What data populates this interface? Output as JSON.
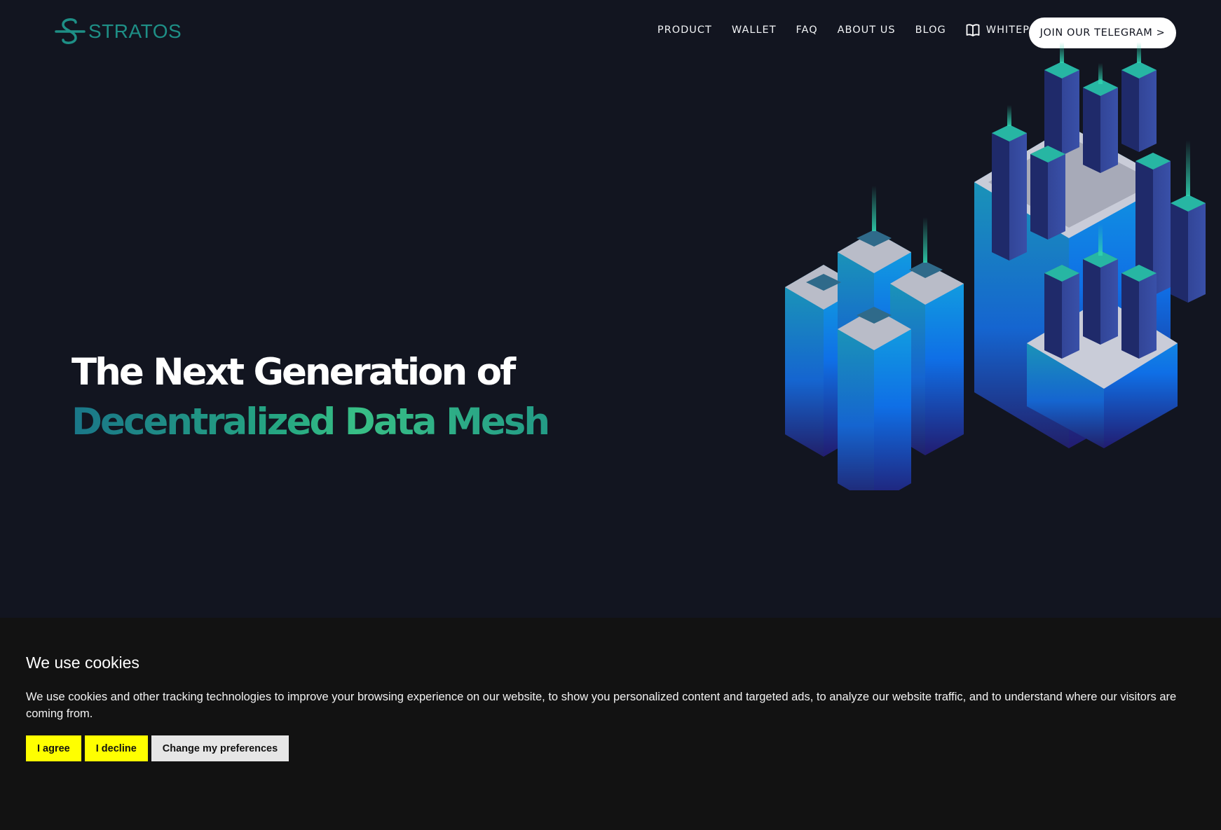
{
  "header": {
    "logo_text": "STRATOS",
    "nav": [
      "PRODUCT",
      "WALLET",
      "FAQ",
      "ABOUT US",
      "BLOG"
    ],
    "whitepaper": "WHITEPAPER",
    "cta": "JOIN OUR TELEGRAM >"
  },
  "hero": {
    "line1": "The Next Generation of",
    "line2": "Decentralized Data Mesh",
    "illustration": "isometric-data-center-city"
  },
  "cookie_banner": {
    "title": "We use cookies",
    "text": "We use cookies and other tracking technologies to improve your browsing experience on our website, to show you personalized content and targeted ads, to analyze our website traffic, and to understand where our visitors are coming from.",
    "agree": "I agree",
    "decline": "I decline",
    "preferences": "Change my preferences"
  },
  "colors": {
    "background": "#121520",
    "brand": "#1e8f86",
    "cookie_bg": "#121212",
    "cookie_button": "#ffff00"
  }
}
